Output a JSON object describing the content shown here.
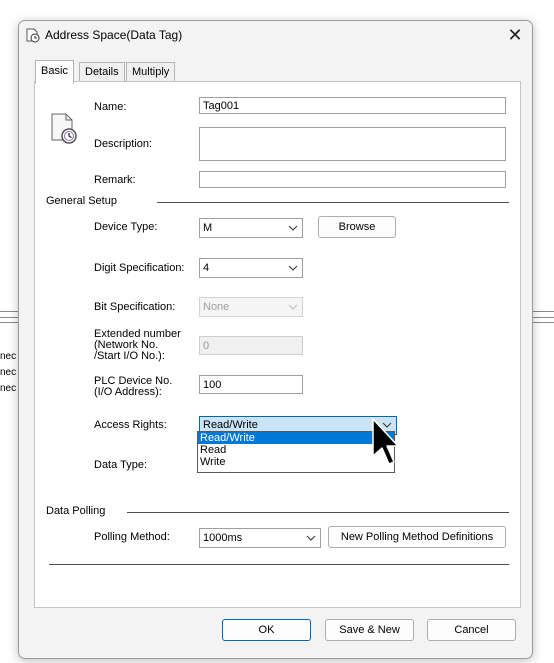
{
  "window": {
    "title": "Address Space(Data Tag)",
    "close_glyph": "✕"
  },
  "tabs": [
    {
      "label": "Basic",
      "active": true
    },
    {
      "label": "Details",
      "active": false
    },
    {
      "label": "Multiply",
      "active": false
    }
  ],
  "background_app": {
    "text_fragments": [
      "nec",
      "nec",
      "nec"
    ]
  },
  "fields": {
    "name_label": "Name:",
    "name_value": "Tag001",
    "description_label": "Description:",
    "description_value": "",
    "remark_label": "Remark:",
    "remark_value": ""
  },
  "general_setup": {
    "heading": "General Setup",
    "device_type_label": "Device Type:",
    "device_type_value": "M",
    "browse_label": "Browse",
    "digit_spec_label": "Digit Specification:",
    "digit_spec_value": "4",
    "bit_spec_label": "Bit Specification:",
    "bit_spec_value": "None",
    "extended_label": "Extended number\n(Network No.\n/Start I/O No.):",
    "extended_value": "0",
    "plc_device_label": "PLC Device No.\n(I/O Address):",
    "plc_device_value": "100",
    "access_rights_label": "Access Rights:",
    "access_rights_value": "Read/Write",
    "access_rights_options": [
      "Read/Write",
      "Read",
      "Write"
    ],
    "access_rights_highlighted": "Read/Write",
    "data_type_label": "Data Type:"
  },
  "data_polling": {
    "heading": "Data Polling",
    "polling_method_label": "Polling Method:",
    "polling_method_value": "1000ms",
    "new_polling_label": "New Polling Method Definitions"
  },
  "buttons": {
    "ok": "OK",
    "save_new": "Save & New",
    "cancel": "Cancel"
  },
  "colors": {
    "accent": "#0078d7",
    "focus_fill": "#cce4f7",
    "dialog_bg": "#f3f3f3"
  },
  "icons": {
    "window_icon": "tag-clock-icon",
    "tag_icon": "document-clock-icon",
    "cursor": "mouse-pointer-icon"
  }
}
